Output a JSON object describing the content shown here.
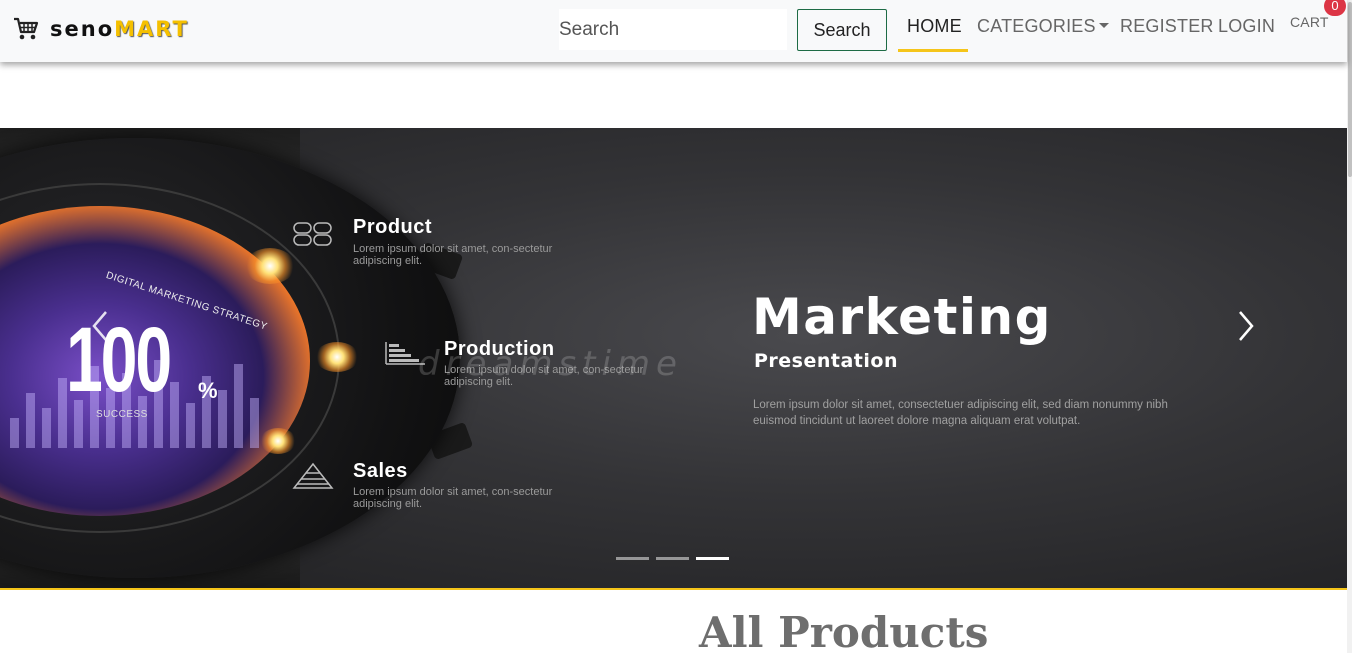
{
  "brand": {
    "prefix": "seno",
    "suffix": "MART",
    "icon": "shopping-cart-icon",
    "accent_color": "#f5c000"
  },
  "search": {
    "placeholder": "Search",
    "button_label": "Search"
  },
  "nav": {
    "home": "HOME",
    "categories": "CATEGORIES",
    "register": "REGISTER",
    "login": "LOGIN",
    "cart": "CART",
    "cart_count": "0",
    "active": "HOME",
    "active_color": "#f5c51a"
  },
  "carousel": {
    "features": [
      {
        "title": "Product",
        "desc": "Lorem ipsum dolor sit amet, con-sectetur adipiscing elit.",
        "icon": "grid-icon"
      },
      {
        "title": "Production",
        "desc": "Lorem ipsum dolor sit amet, con-sectetur adipiscing elit.",
        "icon": "bar-chart-icon"
      },
      {
        "title": "Sales",
        "desc": "Lorem ipsum dolor sit amet, con-sectetur adipiscing elit.",
        "icon": "pyramid-icon"
      }
    ],
    "face": {
      "arc_text": "DIGITAL MARKETING STRATEGY",
      "value": "100",
      "unit": "%",
      "caption": "SUCCESS"
    },
    "watermark": "dreamstime",
    "headline": "Marketing",
    "subheadline": "Presentation",
    "description": "Lorem ipsum dolor sit amet, consectetuer adipiscing elit, sed diam nonummy nibh euismod tincidunt ut laoreet dolore magna aliquam erat volutpat.",
    "slide_count": 3,
    "active_slide": 3,
    "prev_icon": "chevron-left-icon",
    "next_icon": "chevron-right-icon"
  },
  "section": {
    "title": "All Products"
  }
}
